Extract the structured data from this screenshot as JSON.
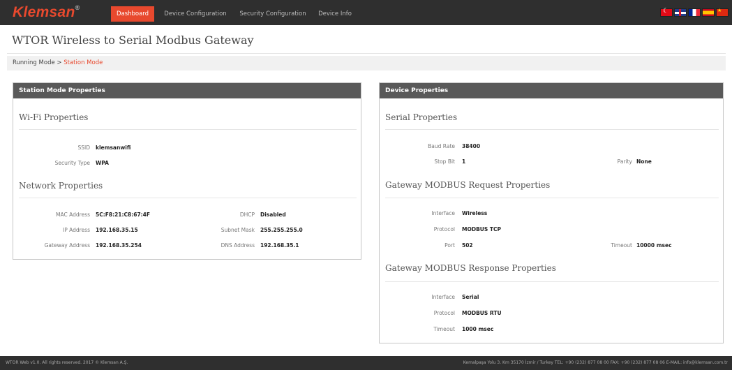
{
  "brand": {
    "name": "Klemsan",
    "mark": "®"
  },
  "nav": {
    "dashboard": "Dashboard",
    "device_configuration": "Device Configuration",
    "security_configuration": "Security Configuration",
    "device_info": "Device Info"
  },
  "flags": [
    "turkish-flag",
    "uk-flag",
    "french-flag",
    "spanish-flag",
    "chinese-flag"
  ],
  "page_title": "WTOR Wireless to Serial Modbus Gateway",
  "breadcrumb": {
    "root": "Running Mode",
    "separator": ">",
    "current": "Station Mode"
  },
  "station_panel": {
    "title": "Station Mode Properties",
    "wifi": {
      "title": "Wi-Fi Properties",
      "ssid_label": "SSID",
      "ssid": "klemsanwifi",
      "security_label": "Security Type",
      "security": "WPA"
    },
    "network": {
      "title": "Network Properties",
      "mac_label": "MAC Address",
      "mac": "5C:F8:21:C8:67:4F",
      "dhcp_label": "DHCP",
      "dhcp": "Disabled",
      "ip_label": "IP Address",
      "ip": "192.168.35.15",
      "mask_label": "Subnet Mask",
      "mask": "255.255.255.0",
      "gateway_label": "Gateway Address",
      "gateway": "192.168.35.254",
      "dns_label": "DNS Address",
      "dns": "192.168.35.1"
    }
  },
  "device_panel": {
    "title": "Device Properties",
    "serial": {
      "title": "Serial Properties",
      "baud_label": "Baud Rate",
      "baud": "38400",
      "stop_label": "Stop Bit",
      "stop": "1",
      "parity_label": "Parity",
      "parity": "None"
    },
    "request": {
      "title": "Gateway MODBUS Request Properties",
      "interface_label": "Interface",
      "interface": "Wireless",
      "protocol_label": "Protocol",
      "protocol": "MODBUS TCP",
      "port_label": "Port",
      "port": "502",
      "timeout_label": "Timeout",
      "timeout": "10000 msec"
    },
    "response": {
      "title": "Gateway MODBUS Response Properties",
      "interface_label": "Interface",
      "interface": "Serial",
      "protocol_label": "Protocol",
      "protocol": "MODBUS RTU",
      "timeout_label": "Timeout",
      "timeout": "1000 msec"
    }
  },
  "footer": {
    "left": "WTOR Web v1.0. All rights reserved. 2017 © Klemsan A.Ş.",
    "right": "Kemalpaşa Yolu 3. Km 35170 İzmir / Turkey TEL: +90 (232) 877 08 00 FAX: +90 (232) 877 08 06 E-MAIL: info@klemsan.com.tr"
  },
  "colors": {
    "accent": "#e8492e",
    "topbar": "#2f2f2f",
    "panel_header": "#595959"
  }
}
